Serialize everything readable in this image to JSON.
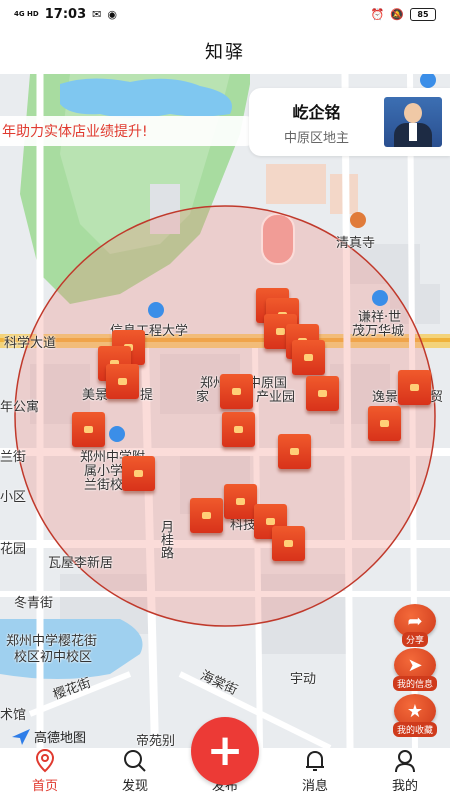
{
  "status_bar": {
    "network": "4G HD",
    "time": "17:03",
    "battery": "85"
  },
  "header": {
    "title": "知驿"
  },
  "banner": {
    "text": "年助力实体店业绩提升!"
  },
  "landlord_card": {
    "name": "屹企铭",
    "role": "中原区地主"
  },
  "map_labels": {
    "university": "信息工程大学",
    "kexue_road": "科学大道",
    "mosque": "清真寺",
    "qianxiang": "谦祥·世",
    "maowanhua": "茂万华城",
    "meijing": "美景",
    "meijing2": "提",
    "park_a": "郑州",
    "park_b": "中原国",
    "park_c": "家",
    "park_d": "产业园",
    "gongyu": "年公寓",
    "yijing": "逸景",
    "yijing2": "贸",
    "sanjie": "兰街",
    "school_1": "郑州中学附",
    "school_2": "属小学",
    "school_3": "兰街校区",
    "xiaoqu": "小区",
    "huayuan": "花园",
    "yuegui": "月桂路",
    "kejiyuan": "科技园",
    "wawu": "瓦屋李新居",
    "dongqing": "冬青街",
    "school_4": "郑州中学樱花街",
    "school_5": "校区初中校区",
    "yinghua": "樱花街",
    "haitang": "海棠街",
    "yudong": "宇动",
    "diyuan": "帝苑别",
    "guan": "术馆"
  },
  "side_buttons": [
    {
      "label": "分享",
      "icon": "share-icon"
    },
    {
      "label": "我的信息",
      "icon": "send-icon"
    },
    {
      "label": "我的收藏",
      "icon": "star-icon"
    }
  ],
  "amap": {
    "label": "高德地图"
  },
  "publish": {
    "symbol": "+"
  },
  "nav": {
    "items": [
      {
        "label": "首页",
        "icon": "location-pin-icon",
        "active": true
      },
      {
        "label": "发现",
        "icon": "search-icon",
        "active": false
      },
      {
        "label": "发布",
        "icon": "publish-icon",
        "active": false
      },
      {
        "label": "消息",
        "icon": "bell-icon",
        "active": false
      },
      {
        "label": "我的",
        "icon": "user-icon",
        "active": false
      }
    ]
  },
  "colors": {
    "accent": "#e03a2f",
    "pin": "#e0451f",
    "circle_fill": "rgba(240,130,120,0.28)",
    "circle_stroke": "#c0392b"
  }
}
